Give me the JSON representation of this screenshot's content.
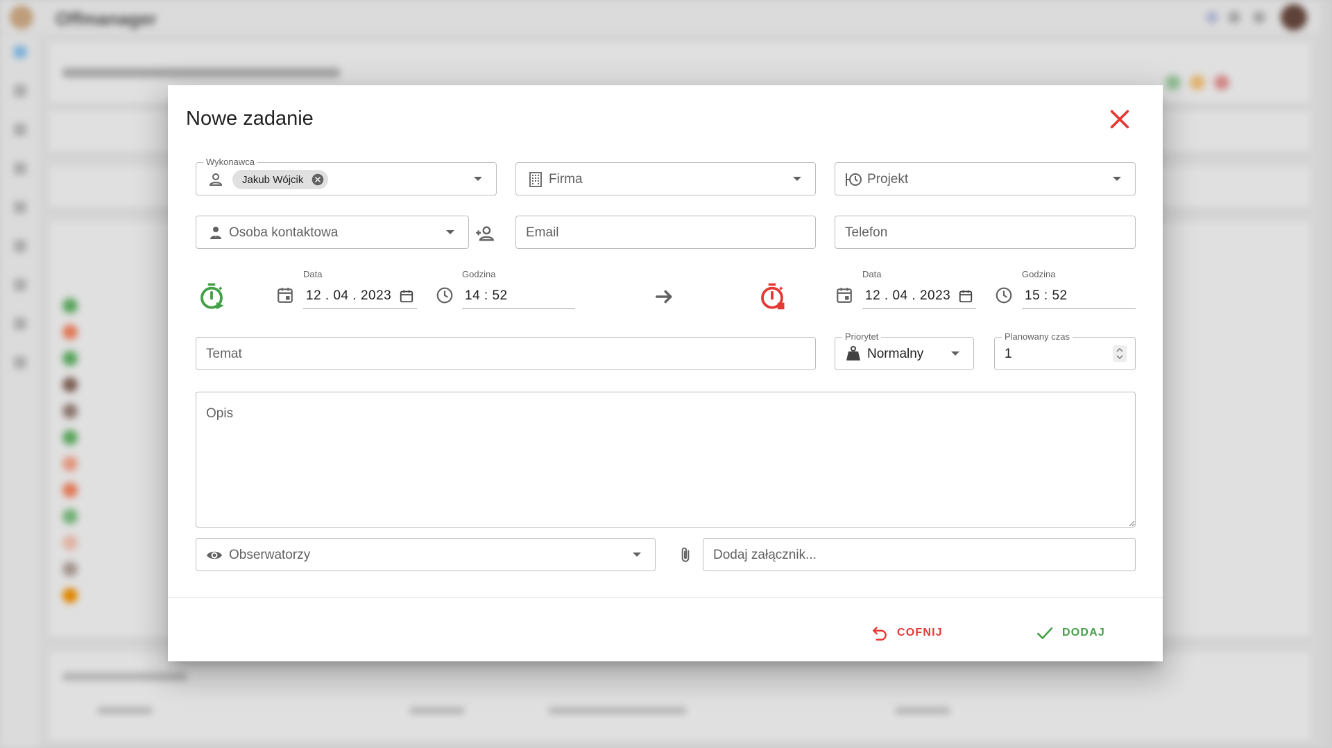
{
  "background": {
    "brand": "Offmanager"
  },
  "dialog": {
    "title": "Nowe zadanie",
    "fields": {
      "assignee_label": "Wykonawca",
      "assignee_chip": "Jakub Wójcik",
      "company_placeholder": "Firma",
      "project_placeholder": "Projekt",
      "contact_placeholder": "Osoba kontaktowa",
      "email_placeholder": "Email",
      "phone_placeholder": "Telefon",
      "subject_placeholder": "Temat",
      "priority_label": "Priorytet",
      "priority_value": "Normalny",
      "planned_time_label": "Planowany czas",
      "planned_time_value": "1",
      "description_placeholder": "Opis",
      "observers_placeholder": "Obserwatorzy",
      "attachment_placeholder": "Dodaj załącznik..."
    },
    "start": {
      "date_label": "Data",
      "date_value": "12 . 04 . 2023",
      "time_label": "Godzina",
      "time_value": "14 : 52"
    },
    "end": {
      "date_label": "Data",
      "date_value": "12 . 04 . 2023",
      "time_label": "Godzina",
      "time_value": "15 : 52"
    },
    "buttons": {
      "cancel": "COFNIJ",
      "add": "DODAJ"
    },
    "colors": {
      "start_timer": "#43a047",
      "end_timer": "#e53935",
      "close": "#e53935"
    }
  }
}
